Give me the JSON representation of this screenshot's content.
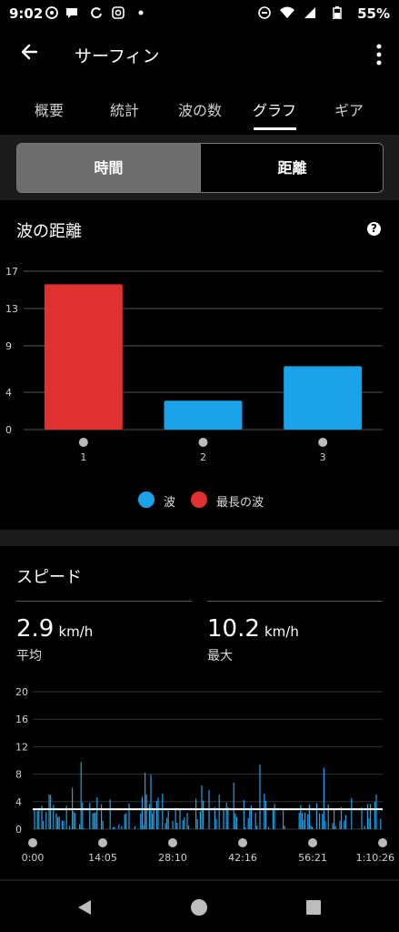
{
  "status": {
    "time": "9:02",
    "left_icons": [
      "notification-icon",
      "chat-icon",
      "sync-icon",
      "instagram-icon",
      "dot-icon"
    ],
    "right_icons": [
      "dnd-icon",
      "wifi-icon",
      "signal-icon",
      "battery-icon"
    ],
    "battery": "55%"
  },
  "appbar": {
    "title": "サーフィン"
  },
  "tabs": [
    {
      "label": "概要"
    },
    {
      "label": "統計"
    },
    {
      "label": "波の数"
    },
    {
      "label": "グラフ",
      "active": true
    },
    {
      "label": "ギア"
    }
  ],
  "segment": {
    "left": "時間",
    "right": "距離",
    "selected": "left"
  },
  "wave_chart": {
    "title": "波の距離",
    "colors": {
      "wave": "#1aa3e8",
      "longest": "#e03030"
    },
    "legend": [
      {
        "label": "波",
        "color": "#1aa3e8"
      },
      {
        "label": "最長の波",
        "color": "#e03030"
      }
    ]
  },
  "speed": {
    "title": "スピード",
    "avg_value": "2.9",
    "avg_unit": "km/h",
    "avg_label": "平均",
    "max_value": "10.2",
    "max_unit": "km/h",
    "max_label": "最大"
  },
  "chart_data": [
    {
      "type": "bar",
      "title": "波の距離",
      "categories": [
        "1",
        "2",
        "3"
      ],
      "series": [
        {
          "name": "最長の波",
          "values": [
            15.6,
            null,
            null
          ]
        },
        {
          "name": "波",
          "values": [
            null,
            3.1,
            6.8
          ]
        }
      ],
      "yticks": [
        "0",
        "4",
        "9",
        "13",
        "17"
      ],
      "ylim": [
        0,
        17
      ],
      "grid": true,
      "legend": "bottom"
    },
    {
      "type": "area",
      "title": "スピード",
      "xticks": [
        "0:00",
        "14:05",
        "28:10",
        "42:16",
        "56:21",
        "1:10:26"
      ],
      "yticks": [
        "0",
        "4",
        "8",
        "12",
        "16",
        "20"
      ],
      "ylim": [
        0,
        20
      ],
      "average": 2.9,
      "max": 10.2,
      "grid": true
    }
  ]
}
